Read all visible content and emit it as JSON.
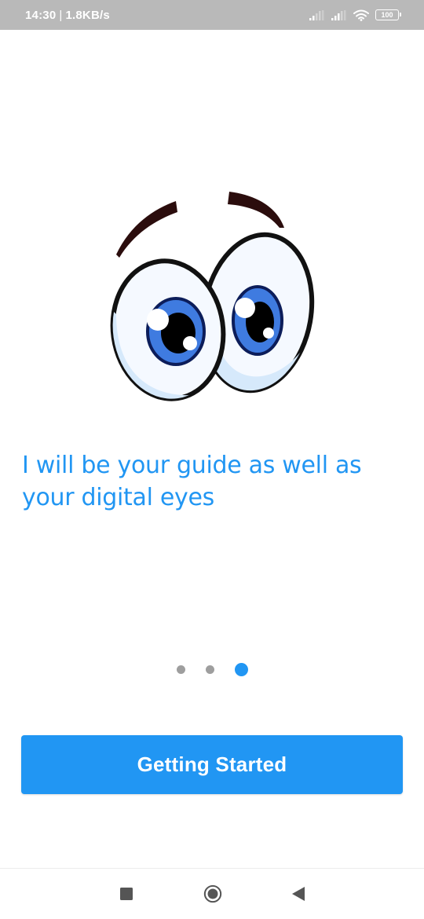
{
  "status_bar": {
    "time": "14:30",
    "separator": "|",
    "network_speed": "1.8KB/s",
    "battery_level": "100",
    "icons": [
      "signal-icon",
      "signal-icon",
      "wifi-icon",
      "battery-icon"
    ]
  },
  "onboarding": {
    "headline": "I will be your guide as well as your digital eyes",
    "illustration": "cartoon-eyes",
    "pages_total": 3,
    "current_page": 3
  },
  "cta": {
    "label": "Getting Started"
  },
  "nav_bar": {
    "icons": [
      "recents-square-icon",
      "home-circle-icon",
      "back-triangle-icon"
    ]
  },
  "colors": {
    "accent": "#2196f3",
    "status_bar_bg": "#b9b9b9",
    "dot_inactive": "#9e9e9e",
    "background": "#ffffff"
  }
}
